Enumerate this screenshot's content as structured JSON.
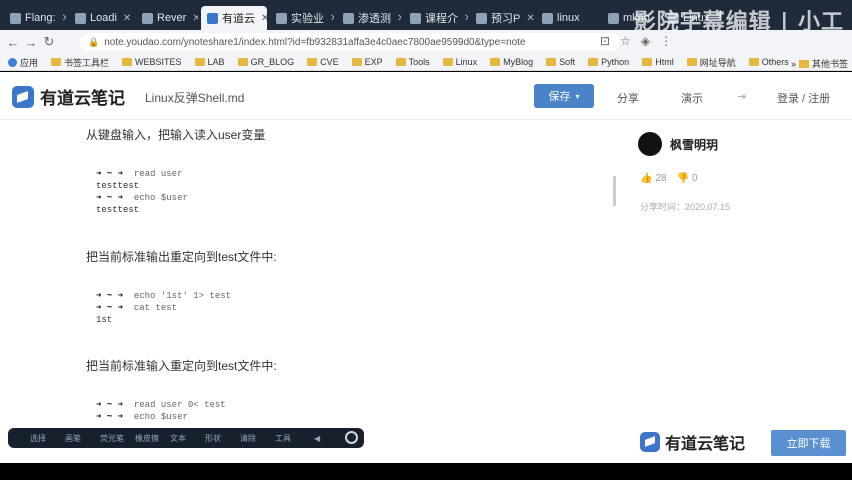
{
  "browser": {
    "tabs": [
      {
        "label": "Flang:",
        "x": "✕"
      },
      {
        "label": "Loadi",
        "x": "✕"
      },
      {
        "label": "Rever",
        "x": "✕"
      },
      {
        "label": "有道云",
        "x": "✕",
        "active": true
      },
      {
        "label": "实验业",
        "x": "✕"
      },
      {
        "label": "渗透测",
        "x": "✕"
      },
      {
        "label": "课程介",
        "x": "✕"
      },
      {
        "label": "预习P",
        "x": "✕"
      },
      {
        "label": "linux",
        "x": ""
      },
      {
        "label": "mkno",
        "x": ""
      },
      {
        "label": "Linux",
        "x": ""
      }
    ],
    "new_tab": "+",
    "watermark": "影院字幕编辑 | 小工",
    "url": "note.youdao.com/ynoteshare1/index.html?id=fb932831affa3e4c0aec7800ae9599d0&type=note",
    "bookmarks": [
      "应用",
      "书签工具栏",
      "WEBSITES",
      "LAB",
      "GR_BLOG",
      "CVE",
      "EXP",
      "Tools",
      "Linux",
      "MyBlog",
      "Soft",
      "Python",
      "Html",
      "网址导航",
      "Others"
    ],
    "bookmarks_more": "»",
    "bookmarks_other": "其他书签"
  },
  "header": {
    "logo_text": "有道云笔记",
    "doc_title": "Linux反弹Shell.md",
    "save_label": "保存",
    "share_label": "分享",
    "present_label": "演示",
    "login_label": "登录 / 注册"
  },
  "content": {
    "sections": [
      {
        "heading": "从键盘输入，把输入读入user变量",
        "lines": [
          {
            "prompt": "➜ ~ ➜",
            "cmd": "read user"
          },
          {
            "prompt": "",
            "cmd": "testtest"
          },
          {
            "prompt": "➜ ~ ➜",
            "cmd": "echo $user"
          },
          {
            "prompt": "",
            "cmd": "testtest"
          }
        ]
      },
      {
        "heading": "把当前标准输出重定向到test文件中:",
        "lines": [
          {
            "prompt": "➜ ~ ➜",
            "cmd": "echo '1st' 1> test"
          },
          {
            "prompt": "➜ ~ ➜",
            "cmd": "cat test"
          },
          {
            "prompt": "",
            "cmd": "1st"
          }
        ]
      },
      {
        "heading": "把当前标准输入重定向到test文件中:",
        "lines": [
          {
            "prompt": "➜ ~ ➜",
            "cmd": "read user 0< test"
          },
          {
            "prompt": "➜ ~ ➜",
            "cmd": "echo $user"
          }
        ]
      }
    ]
  },
  "sidebar": {
    "author": "枫雪明玥",
    "likes": "28",
    "dislikes": "0",
    "share_time": "分享时间：2020.07.15"
  },
  "footer": {
    "logo_text": "有道云笔记",
    "download_label": "立即下载"
  },
  "floating_toolbar": {
    "items": [
      "选择",
      "画笔",
      "荧光笔",
      "橡皮擦",
      "文本",
      "形状",
      "清除",
      "工具"
    ],
    "arrow": "◀"
  },
  "colors": {
    "accent": "#4b83c9",
    "tab_bg": "#1f2b3a",
    "float_bar": "#17202c"
  }
}
